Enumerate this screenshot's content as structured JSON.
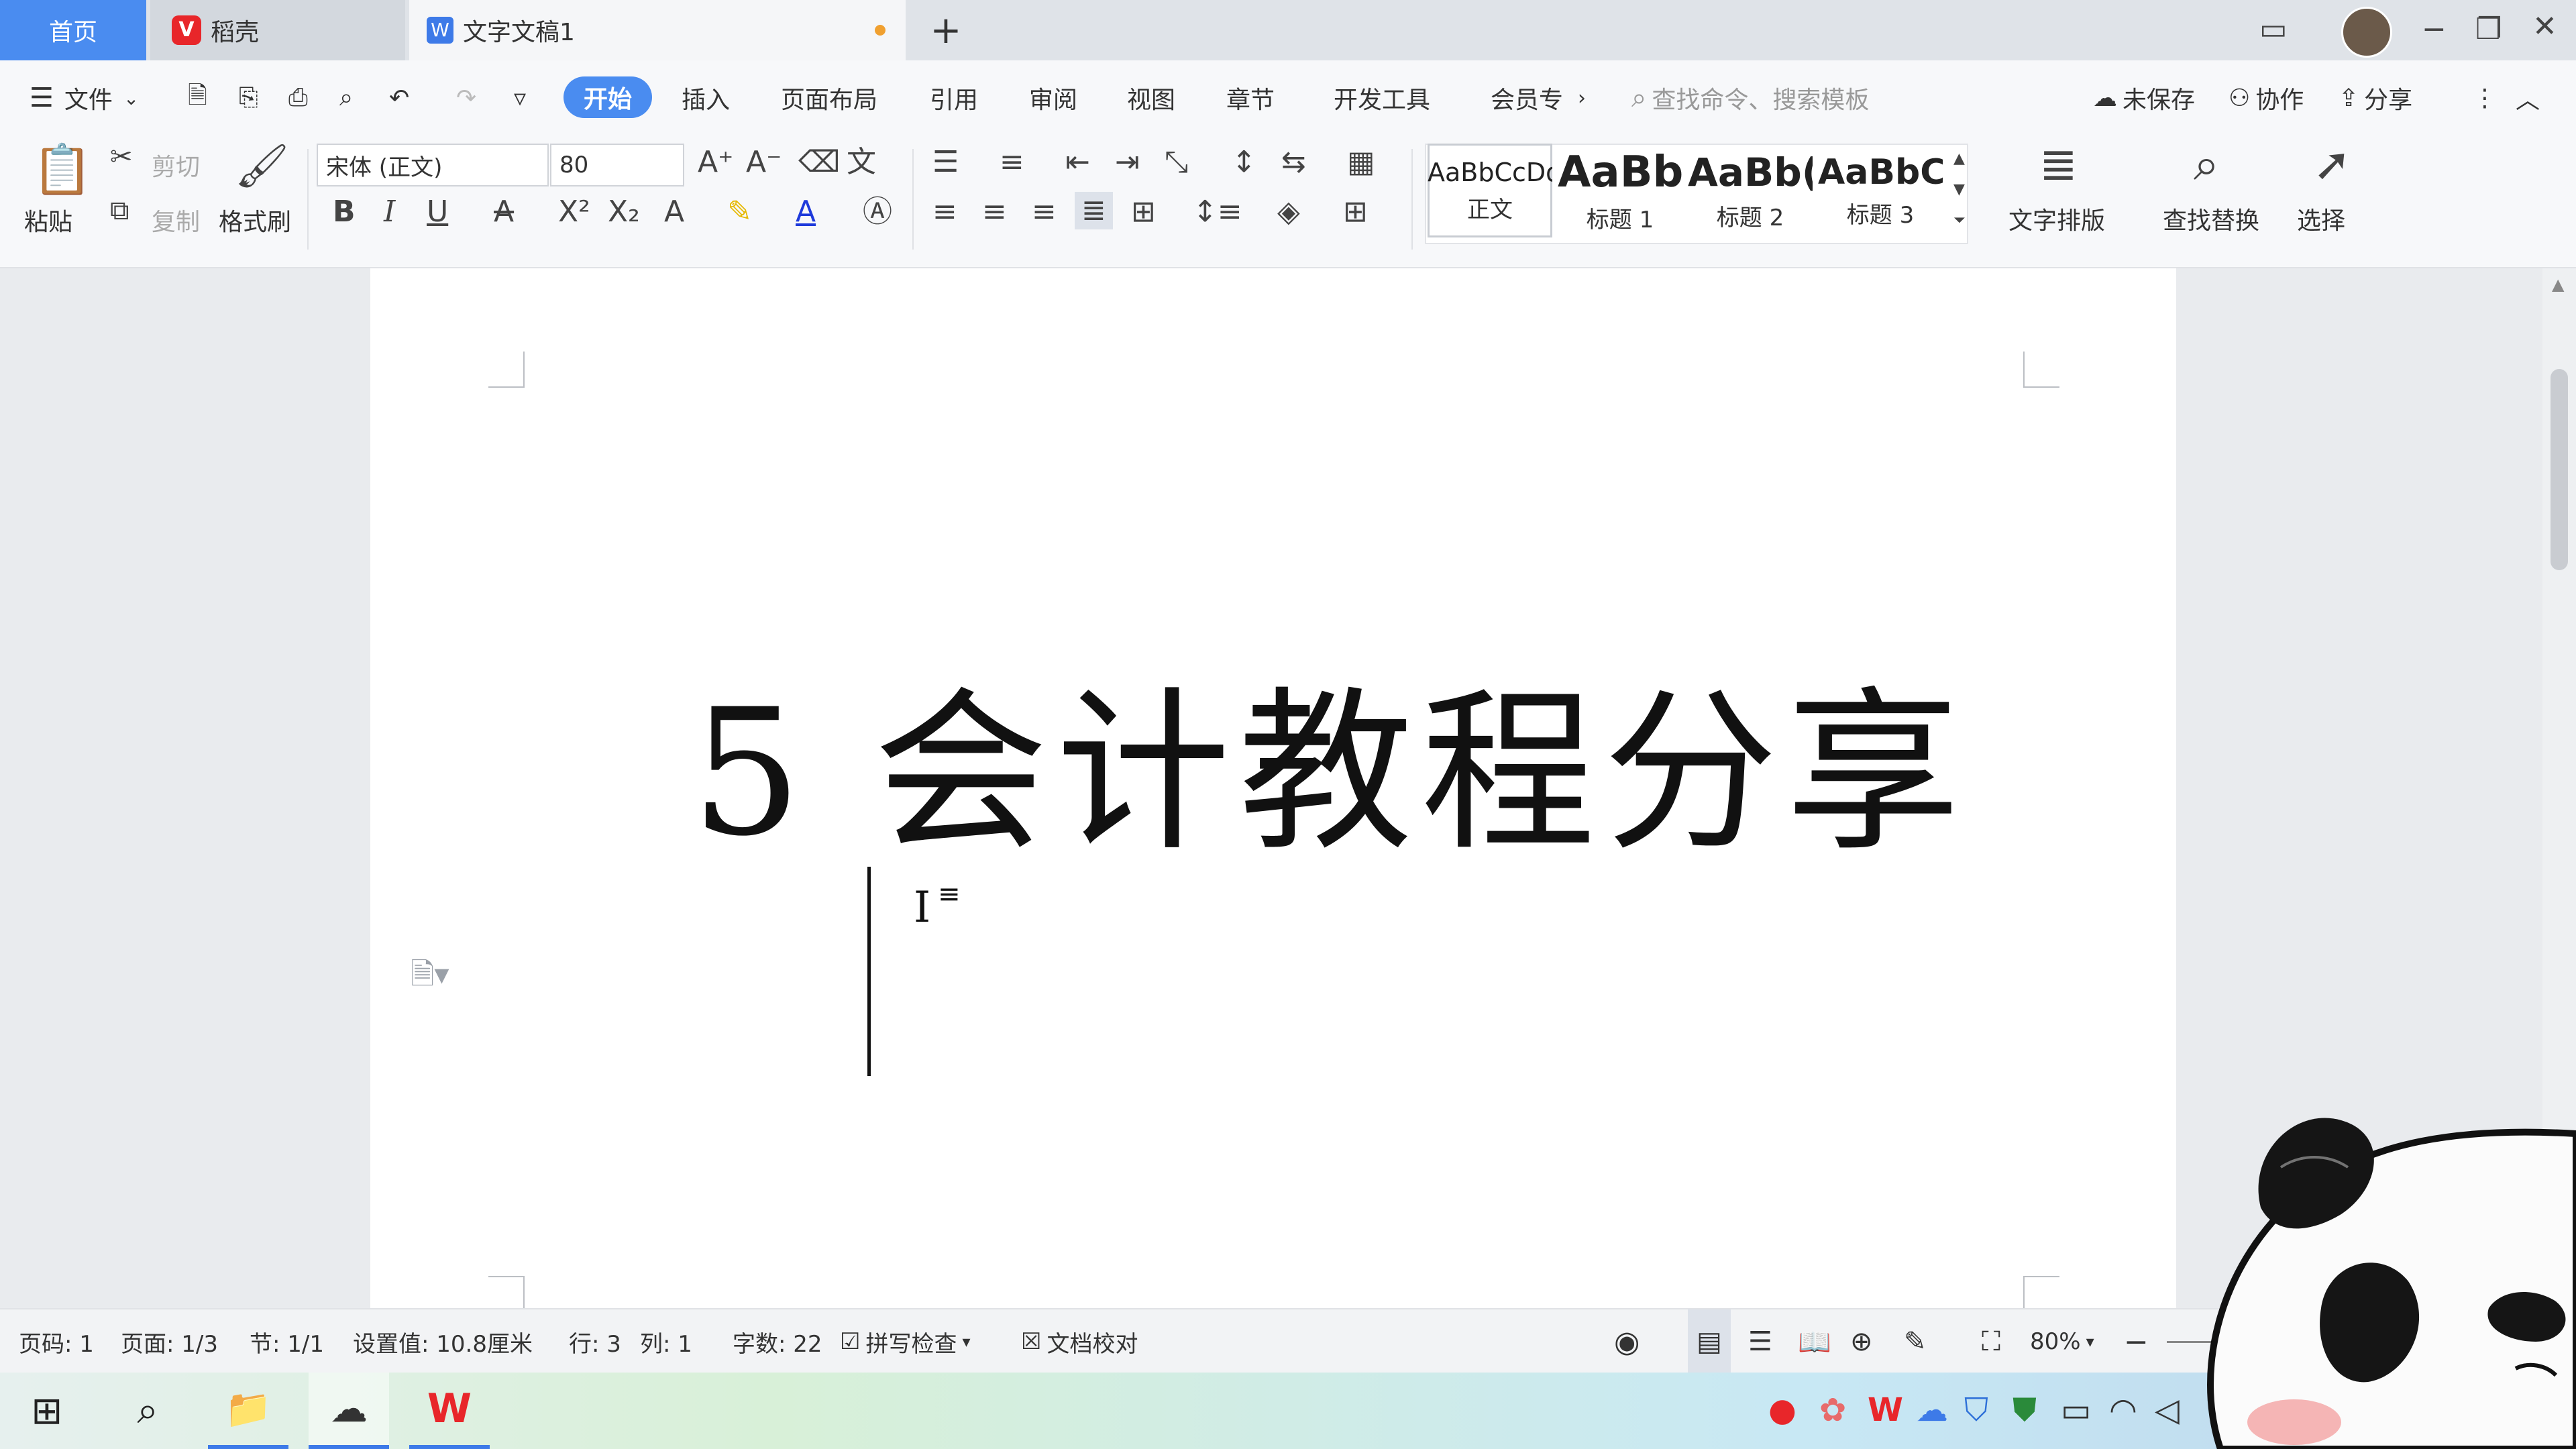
{
  "tabs": {
    "home": "首页",
    "daoke": "稻壳",
    "doc": "文字文稿1",
    "new_tab": "+"
  },
  "menu": {
    "file": "文件",
    "items": [
      "开始",
      "插入",
      "页面布局",
      "引用",
      "审阅",
      "视图",
      "章节",
      "开发工具",
      "会员专"
    ],
    "search_placeholder": "查找命令、搜索模板",
    "unsaved": "未保存",
    "collab": "协作",
    "share": "分享"
  },
  "ribbon": {
    "paste": "粘贴",
    "cut": "剪切",
    "copy": "复制",
    "format_painter": "格式刷",
    "font_name": "宋体 (正文)",
    "font_size": "80",
    "styles": [
      {
        "preview": "AaBbCcDd",
        "name": "正文"
      },
      {
        "preview": "AaBb",
        "name": "标题 1"
      },
      {
        "preview": "AaBb(",
        "name": "标题 2"
      },
      {
        "preview": "AaBbC",
        "name": "标题 3"
      }
    ],
    "text_layout": "文字排版",
    "find_replace": "查找替换",
    "select": "选择"
  },
  "document": {
    "title": "5 会计教程分享"
  },
  "status": {
    "page_code": "页码: 1",
    "page": "页面: 1/3",
    "section": "节: 1/1",
    "setting": "设置值: 10.8厘米",
    "row": "行: 3",
    "col": "列: 1",
    "word_count": "字数: 22",
    "spell_check": "拼写检查",
    "proofread": "文档校对",
    "zoom": "80%"
  },
  "colors": {
    "accent": "#4a8cf0",
    "wps_red": "#e8262a"
  }
}
